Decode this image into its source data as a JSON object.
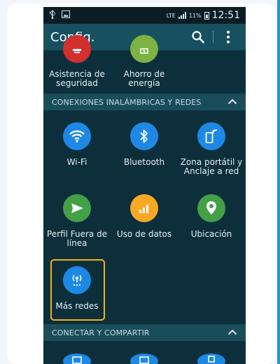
{
  "status_bar": {
    "network": "LTE",
    "battery": "11%",
    "time": "12:51"
  },
  "app_bar": {
    "title": "Config."
  },
  "top_items": [
    {
      "label": "Asistencia de seguridad",
      "icon": "security-assistance-icon",
      "color": "#d32f2f"
    },
    {
      "label": "Ahorro de energía",
      "icon": "power-saving-icon",
      "color": "#7cb342"
    }
  ],
  "sections": {
    "wireless": {
      "header": "CONEXIONES INALÁMBRICAS Y REDES",
      "items": [
        {
          "label": "Wi-Fi",
          "icon": "wifi-icon",
          "color": "#1e88e5"
        },
        {
          "label": "Bluetooth",
          "icon": "bluetooth-icon",
          "color": "#1e88e5"
        },
        {
          "label": "Zona portátil y Anclaje a red",
          "icon": "hotspot-icon",
          "color": "#1e88e5"
        },
        {
          "label": "Perfil Fuera de línea",
          "icon": "airplane-icon",
          "color": "#43a047"
        },
        {
          "label": "Uso de datos",
          "icon": "data-usage-icon",
          "color": "#f9a825"
        },
        {
          "label": "Ubicación",
          "icon": "location-icon",
          "color": "#43a047"
        },
        {
          "label": "Más redes",
          "icon": "more-networks-icon",
          "color": "#1e88e5"
        }
      ]
    },
    "connect": {
      "header": "CONECTAR Y COMPARTIR"
    }
  },
  "colors": {
    "highlight": "#f2b11a",
    "background": "#0d2f3c",
    "app_bar": "#17505e"
  }
}
